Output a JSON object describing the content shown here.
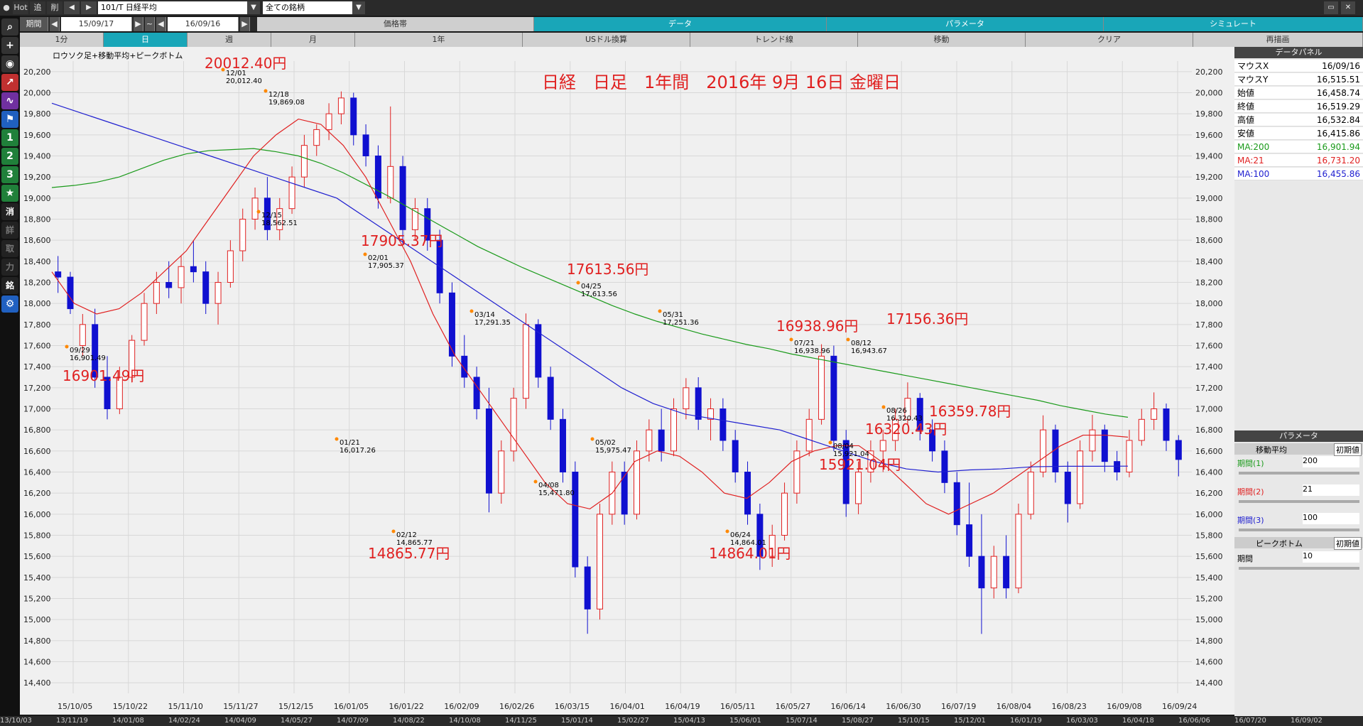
{
  "toolbar": {
    "hot": "Hot",
    "tsui": "追",
    "sakujo": "削",
    "code_field": "101/T 日経平均",
    "filter_field": "全ての銘柄"
  },
  "period": {
    "label": "期間",
    "from": "15/09/17",
    "tilde": "~",
    "to": "16/09/16"
  },
  "tabs_row1": [
    "価格帯",
    "データ",
    "パラメータ",
    "シミュレート"
  ],
  "tabs_row2": [
    "1分",
    "日",
    "週",
    "月",
    "1年",
    "USドル換算",
    "トレンド線",
    "移動",
    "クリア",
    "再描画"
  ],
  "left_icons": [
    "1",
    "2",
    "3",
    "★",
    "消",
    "詳",
    "取",
    "力",
    "銘"
  ],
  "chart": {
    "legend_label": "ロウソク足+移動平均+ピークボトム",
    "title": "日経　日足　1年間　2016年 9月 16日 金曜日",
    "y_ticks": [
      "20,200",
      "20,000",
      "19,800",
      "19,600",
      "19,400",
      "19,200",
      "19,000",
      "18,800",
      "18,600",
      "18,400",
      "18,200",
      "18,000",
      "17,800",
      "17,600",
      "17,400",
      "17,200",
      "17,000",
      "16,800",
      "16,600",
      "16,400",
      "16,200",
      "16,000",
      "15,800",
      "15,600",
      "15,400",
      "15,200",
      "15,000",
      "14,800",
      "14,600",
      "14,400"
    ],
    "x_ticks": [
      "15/10/05",
      "15/10/22",
      "15/11/10",
      "15/11/27",
      "15/12/15",
      "16/01/05",
      "16/01/22",
      "16/02/09",
      "16/02/26",
      "16/03/15",
      "16/04/01",
      "16/04/19",
      "16/05/11",
      "16/05/27",
      "16/06/14",
      "16/06/30",
      "16/07/19",
      "16/08/04",
      "16/08/23",
      "16/09/08",
      "16/09/24"
    ],
    "peaks": [
      {
        "d": "09/29",
        "v": "16,901.49",
        "big": "16901.49円"
      },
      {
        "d": "12/01",
        "v": "20,012.40",
        "big": "20012.40円"
      },
      {
        "d": "12/18",
        "v": "19,869.08",
        "big": ""
      },
      {
        "d": "12/15",
        "v": "18,562.51",
        "big": ""
      },
      {
        "d": "01/21",
        "v": "16,017.26",
        "big": ""
      },
      {
        "d": "02/01",
        "v": "17,905.37",
        "big": "17905.37円"
      },
      {
        "d": "02/12",
        "v": "14,865.77",
        "big": "14865.77円"
      },
      {
        "d": "03/14",
        "v": "17,291.35",
        "big": ""
      },
      {
        "d": "04/08",
        "v": "15,471.80",
        "big": ""
      },
      {
        "d": "04/25",
        "v": "17,613.56",
        "big": "17613.56円"
      },
      {
        "d": "05/02",
        "v": "15,975.47",
        "big": ""
      },
      {
        "d": "05/31",
        "v": "17,251.36",
        "big": ""
      },
      {
        "d": "06/24",
        "v": "14,864.01",
        "big": "14864.01円"
      },
      {
        "d": "07/21",
        "v": "16,938.96",
        "big": "16938.96円"
      },
      {
        "d": "08/04",
        "v": "15,921.04",
        "big": "15921.04円"
      },
      {
        "d": "08/12",
        "v": "16,943.67",
        "big": ""
      },
      {
        "d": "08/26",
        "v": "16,320.43",
        "big": "16320.43円"
      },
      {
        "d": "",
        "v": "",
        "big": "17156.36円"
      },
      {
        "d": "",
        "v": "",
        "big": "16359.78円"
      }
    ]
  },
  "data_panel": {
    "title": "データパネル",
    "rows": [
      {
        "k": "マウスX",
        "v": "16/09/16",
        "c": "#000"
      },
      {
        "k": "マウスY",
        "v": "16,515.51",
        "c": "#000"
      },
      {
        "k": "始値",
        "v": "16,458.74",
        "c": "#000"
      },
      {
        "k": "終値",
        "v": "16,519.29",
        "c": "#000"
      },
      {
        "k": "高値",
        "v": "16,532.84",
        "c": "#000"
      },
      {
        "k": "安値",
        "v": "16,415.86",
        "c": "#000"
      },
      {
        "k": "MA:200",
        "v": "16,901.94",
        "c": "#1a9a1a"
      },
      {
        "k": "MA:21",
        "v": "16,731.20",
        "c": "#e02020"
      },
      {
        "k": "MA:100",
        "v": "16,455.86",
        "c": "#2020d0"
      }
    ]
  },
  "param_panel": {
    "title": "パラメータ",
    "ma_label": "移動平均",
    "init_label": "初期値",
    "p1": "期間(1)",
    "p1v": "200",
    "p2": "期間(2)",
    "p2v": "21",
    "p3": "期間(3)",
    "p3v": "100",
    "pb_label": "ピークボトム",
    "pb_init": "初期値",
    "pb_p": "期間",
    "pb_pv": "10"
  },
  "bottom_dates": [
    "13/10/03",
    "13/11/19",
    "14/01/08",
    "14/02/24",
    "14/04/09",
    "14/05/27",
    "14/07/09",
    "14/08/22",
    "14/10/08",
    "14/11/25",
    "15/01/14",
    "15/02/27",
    "15/04/13",
    "15/06/01",
    "15/07/14",
    "15/08/27",
    "15/10/15",
    "15/12/01",
    "16/01/19",
    "16/03/03",
    "16/04/18",
    "16/06/06",
    "16/07/20",
    "16/09/02"
  ],
  "colors": {
    "ma200": "#1a9a1a",
    "ma21": "#e02020",
    "ma100": "#2020d0",
    "up": "#e02020",
    "down": "#1010d0",
    "peak": "#e02020"
  },
  "chart_data": {
    "type": "candlestick",
    "ylim": [
      14400,
      20200
    ],
    "ohlc": [
      [
        18300,
        18450,
        18100,
        18250
      ],
      [
        18250,
        18300,
        17900,
        17950
      ],
      [
        17600,
        17900,
        17500,
        17800
      ],
      [
        17800,
        17950,
        17200,
        17300
      ],
      [
        17300,
        17500,
        16900,
        17000
      ],
      [
        17000,
        17400,
        16950,
        17300
      ],
      [
        17300,
        17700,
        17250,
        17650
      ],
      [
        17650,
        18100,
        17600,
        18000
      ],
      [
        18000,
        18300,
        17900,
        18200
      ],
      [
        18200,
        18400,
        18050,
        18150
      ],
      [
        18150,
        18450,
        18000,
        18350
      ],
      [
        18350,
        18600,
        18200,
        18300
      ],
      [
        18300,
        18400,
        17900,
        18000
      ],
      [
        18000,
        18300,
        17800,
        18200
      ],
      [
        18200,
        18600,
        18150,
        18500
      ],
      [
        18500,
        18900,
        18400,
        18800
      ],
      [
        18800,
        19100,
        18700,
        19000
      ],
      [
        19000,
        19200,
        18600,
        18700
      ],
      [
        18700,
        19000,
        18600,
        18900
      ],
      [
        18900,
        19300,
        18850,
        19200
      ],
      [
        19200,
        19600,
        19100,
        19500
      ],
      [
        19500,
        19700,
        19400,
        19650
      ],
      [
        19650,
        19900,
        19550,
        19800
      ],
      [
        19800,
        20012,
        19700,
        19950
      ],
      [
        19950,
        20000,
        19500,
        19600
      ],
      [
        19600,
        19700,
        19300,
        19400
      ],
      [
        19400,
        19500,
        18900,
        19000
      ],
      [
        19000,
        19869,
        18950,
        19300
      ],
      [
        19300,
        19400,
        18562,
        18700
      ],
      [
        18700,
        19000,
        18600,
        18900
      ],
      [
        18900,
        19000,
        18500,
        18600
      ],
      [
        18600,
        18700,
        18000,
        18100
      ],
      [
        18100,
        18200,
        17400,
        17500
      ],
      [
        17500,
        17700,
        17200,
        17300
      ],
      [
        17300,
        17400,
        16900,
        17000
      ],
      [
        17000,
        17200,
        16017,
        16200
      ],
      [
        16200,
        16700,
        16100,
        16600
      ],
      [
        16600,
        17200,
        16500,
        17100
      ],
      [
        17100,
        17905,
        17000,
        17800
      ],
      [
        17800,
        17850,
        17200,
        17300
      ],
      [
        17300,
        17400,
        16800,
        16900
      ],
      [
        16900,
        17000,
        16300,
        16400
      ],
      [
        16400,
        16500,
        15400,
        15500
      ],
      [
        15500,
        15600,
        14865,
        15100
      ],
      [
        15100,
        16100,
        15000,
        16000
      ],
      [
        16000,
        16500,
        15900,
        16400
      ],
      [
        16400,
        16500,
        15900,
        16000
      ],
      [
        16000,
        16700,
        15950,
        16600
      ],
      [
        16600,
        16900,
        16500,
        16800
      ],
      [
        16800,
        17000,
        16500,
        16600
      ],
      [
        16600,
        17100,
        16550,
        17000
      ],
      [
        17000,
        17291,
        16900,
        17200
      ],
      [
        17200,
        17300,
        16800,
        16900
      ],
      [
        16900,
        17100,
        16700,
        17000
      ],
      [
        17000,
        17100,
        16600,
        16700
      ],
      [
        16700,
        16800,
        16300,
        16400
      ],
      [
        16400,
        16500,
        15900,
        16000
      ],
      [
        16000,
        16100,
        15471,
        15600
      ],
      [
        15600,
        15900,
        15500,
        15800
      ],
      [
        15800,
        16300,
        15750,
        16200
      ],
      [
        16200,
        16700,
        16100,
        16600
      ],
      [
        16600,
        17000,
        16550,
        16900
      ],
      [
        16900,
        17613,
        16850,
        17500
      ],
      [
        17500,
        17600,
        16600,
        16700
      ],
      [
        16700,
        16800,
        15975,
        16100
      ],
      [
        16100,
        16500,
        16000,
        16400
      ],
      [
        16400,
        16700,
        16300,
        16600
      ],
      [
        16600,
        16800,
        16400,
        16700
      ],
      [
        16700,
        17000,
        16600,
        16900
      ],
      [
        16900,
        17251,
        16850,
        17100
      ],
      [
        17100,
        17150,
        16700,
        16800
      ],
      [
        16800,
        16900,
        16500,
        16600
      ],
      [
        16600,
        16700,
        16200,
        16300
      ],
      [
        16300,
        16400,
        15800,
        15900
      ],
      [
        15900,
        16300,
        15500,
        15600
      ],
      [
        15600,
        16000,
        14864,
        15300
      ],
      [
        15300,
        15700,
        15200,
        15600
      ],
      [
        15600,
        15800,
        15200,
        15300
      ],
      [
        15300,
        16100,
        15250,
        16000
      ],
      [
        16000,
        16500,
        15950,
        16400
      ],
      [
        16400,
        16938,
        16350,
        16800
      ],
      [
        16800,
        16850,
        16300,
        16400
      ],
      [
        16400,
        16500,
        15921,
        16100
      ],
      [
        16100,
        16700,
        16050,
        16600
      ],
      [
        16600,
        16943,
        16500,
        16800
      ],
      [
        16800,
        16850,
        16400,
        16500
      ],
      [
        16500,
        16600,
        16320,
        16400
      ],
      [
        16400,
        16800,
        16350,
        16700
      ],
      [
        16700,
        17000,
        16650,
        16900
      ],
      [
        16900,
        17156,
        16800,
        17000
      ],
      [
        17000,
        17050,
        16600,
        16700
      ],
      [
        16700,
        16750,
        16359,
        16519
      ]
    ],
    "ma200": [
      19100,
      19120,
      19150,
      19200,
      19280,
      19360,
      19420,
      19450,
      19460,
      19470,
      19440,
      19400,
      19330,
      19240,
      19130,
      19020,
      18900,
      18780,
      18660,
      18540,
      18440,
      18340,
      18250,
      18160,
      18070,
      17980,
      17900,
      17830,
      17770,
      17710,
      17660,
      17610,
      17570,
      17520,
      17480,
      17440,
      17400,
      17360,
      17320,
      17280,
      17240,
      17200,
      17160,
      17120,
      17080,
      17030,
      16990,
      16950,
      16920
    ],
    "ma21": [
      18300,
      18000,
      17900,
      17950,
      18100,
      18300,
      18500,
      18800,
      19100,
      19400,
      19600,
      19750,
      19700,
      19500,
      19200,
      18800,
      18400,
      17900,
      17500,
      17200,
      16900,
      16600,
      16300,
      16100,
      16050,
      16200,
      16500,
      16600,
      16550,
      16400,
      16200,
      16150,
      16300,
      16500,
      16600,
      16650,
      16650,
      16500,
      16300,
      16100,
      16000,
      16100,
      16200,
      16350,
      16500,
      16650,
      16750,
      16750,
      16731
    ],
    "ma100": [
      19900,
      19800,
      19700,
      19600,
      19500,
      19400,
      19300,
      19200,
      19100,
      19000,
      18800,
      18600,
      18400,
      18200,
      18000,
      17800,
      17600,
      17400,
      17200,
      17050,
      16950,
      16900,
      16850,
      16800,
      16700,
      16600,
      16500,
      16430,
      16400,
      16420,
      16430,
      16450,
      16455,
      16455,
      16456
    ]
  }
}
